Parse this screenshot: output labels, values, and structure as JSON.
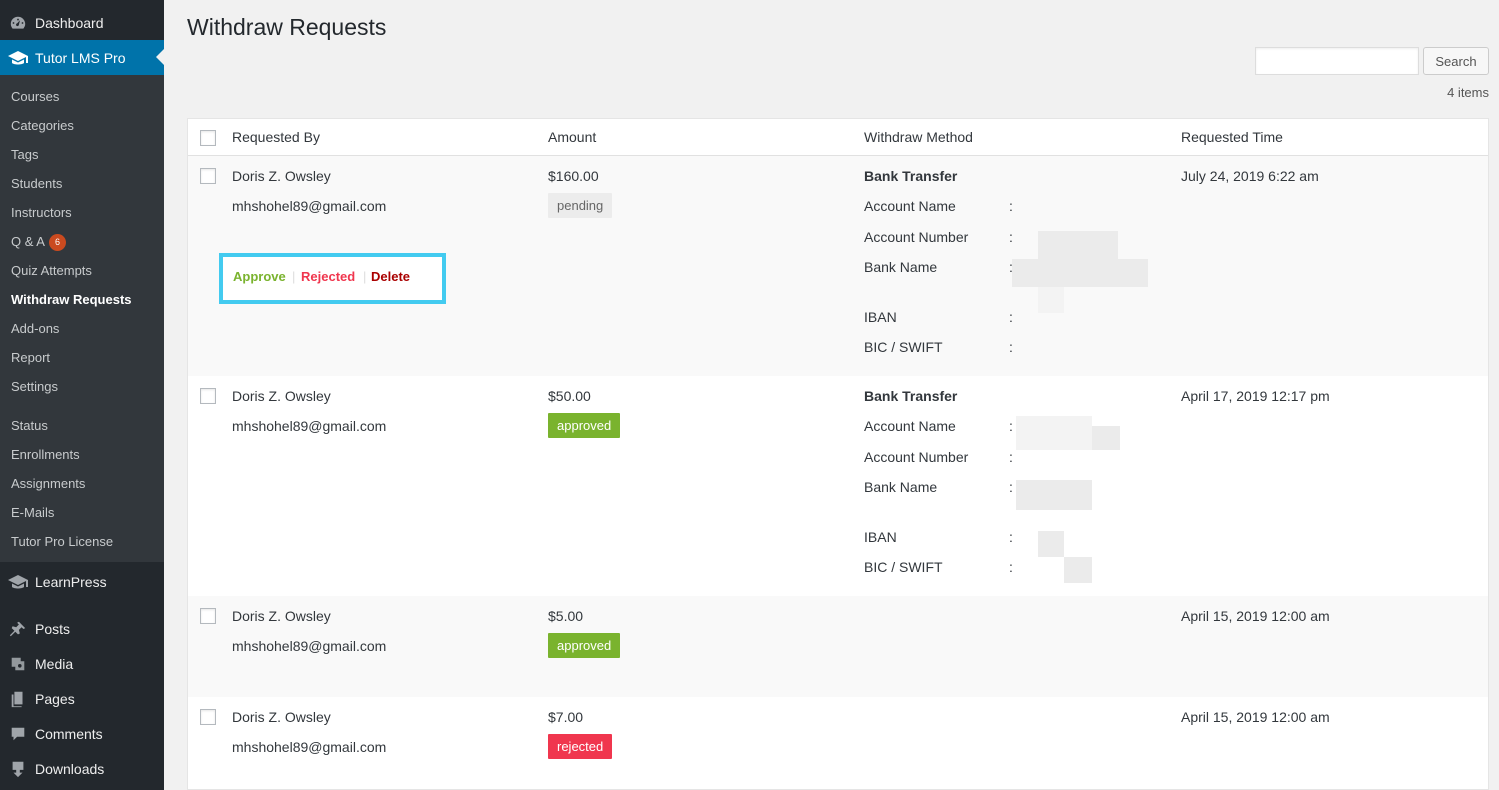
{
  "sidebar": {
    "top_items": [
      {
        "label": "Dashboard",
        "icon": "dashboard-icon"
      },
      {
        "label": "Tutor LMS Pro",
        "icon": "graduation-cap-icon"
      }
    ],
    "submenu": [
      "Courses",
      "Categories",
      "Tags",
      "Students",
      "Instructors",
      "Q & A",
      "Quiz Attempts",
      "Withdraw Requests",
      "Add-ons",
      "Report",
      "Settings",
      "Status",
      "Enrollments",
      "Assignments",
      "E-Mails",
      "Tutor Pro License"
    ],
    "qa_badge": "6",
    "bottom_items": [
      {
        "label": "LearnPress",
        "icon": "graduation-cap-icon"
      },
      {
        "label": "Posts",
        "icon": "pin-icon"
      },
      {
        "label": "Media",
        "icon": "media-icon"
      },
      {
        "label": "Pages",
        "icon": "pages-icon"
      },
      {
        "label": "Comments",
        "icon": "comment-icon"
      },
      {
        "label": "Downloads",
        "icon": "download-icon"
      }
    ]
  },
  "page": {
    "title": "Withdraw Requests",
    "search_button": "Search",
    "items_count": "4 items"
  },
  "table": {
    "headers": [
      "Requested By",
      "Amount",
      "Withdraw Method",
      "Requested Time"
    ],
    "actions": {
      "approve": "Approve",
      "reject": "Rejected",
      "delete": "Delete",
      "separator": "|"
    },
    "method_fields": [
      "Account Name",
      "Account Number",
      "Bank Name",
      "IBAN",
      "BIC / SWIFT"
    ],
    "colon": ":",
    "rows": [
      {
        "name": "Doris Z. Owsley",
        "email": "mhshohel89@gmail.com",
        "amount": "$160.00",
        "status": "pending",
        "method": "Bank Transfer",
        "time": "July 24, 2019 6:22 am"
      },
      {
        "name": "Doris Z. Owsley",
        "email": "mhshohel89@gmail.com",
        "amount": "$50.00",
        "status": "approved",
        "method": "Bank Transfer",
        "time": "April 17, 2019 12:17 pm"
      },
      {
        "name": "Doris Z. Owsley",
        "email": "mhshohel89@gmail.com",
        "amount": "$5.00",
        "status": "approved",
        "method": "",
        "time": "April 15, 2019 12:00 am"
      },
      {
        "name": "Doris Z. Owsley",
        "email": "mhshohel89@gmail.com",
        "amount": "$7.00",
        "status": "rejected",
        "method": "",
        "time": "April 15, 2019 12:00 am"
      }
    ]
  },
  "colors": {
    "sidebar": "#23282d",
    "submenu": "#32373c",
    "accent": "#0073aa",
    "approved": "#7ab32e",
    "rejected": "#f0364e",
    "highlight": "#43cbf0"
  }
}
